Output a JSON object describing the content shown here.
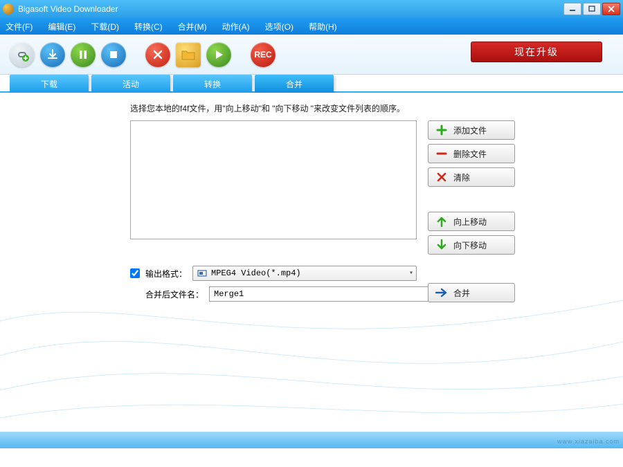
{
  "window": {
    "title": "Bigasoft Video Downloader"
  },
  "menu": {
    "file": "文件(F)",
    "edit": "编辑(E)",
    "download": "下载(D)",
    "convert": "转换(C)",
    "merge": "合并(M)",
    "action": "动作(A)",
    "options": "选项(O)",
    "help": "帮助(H)"
  },
  "toolbar": {
    "rec_label": "REC",
    "upgrade": "现在升级"
  },
  "tabs": {
    "download": "下载",
    "activity": "活动",
    "convert": "转换",
    "merge": "合并"
  },
  "merge_panel": {
    "instruction": "选择您本地的f4f文件，用\"向上移动\"和 \"向下移动 \"来改变文件列表的顺序。",
    "add_file": "添加文件",
    "delete_file": "删除文件",
    "clear": "清除",
    "move_up": "向上移动",
    "move_down": "向下移动",
    "output_format_label": "输出格式：",
    "output_format_value": "MPEG4 Video(*.mp4)",
    "merged_filename_label": "合并后文件名：",
    "merged_filename_value": "Merge1",
    "merge_button": "合并",
    "output_format_checked": true
  },
  "watermark": "www.xiazaiba.com"
}
